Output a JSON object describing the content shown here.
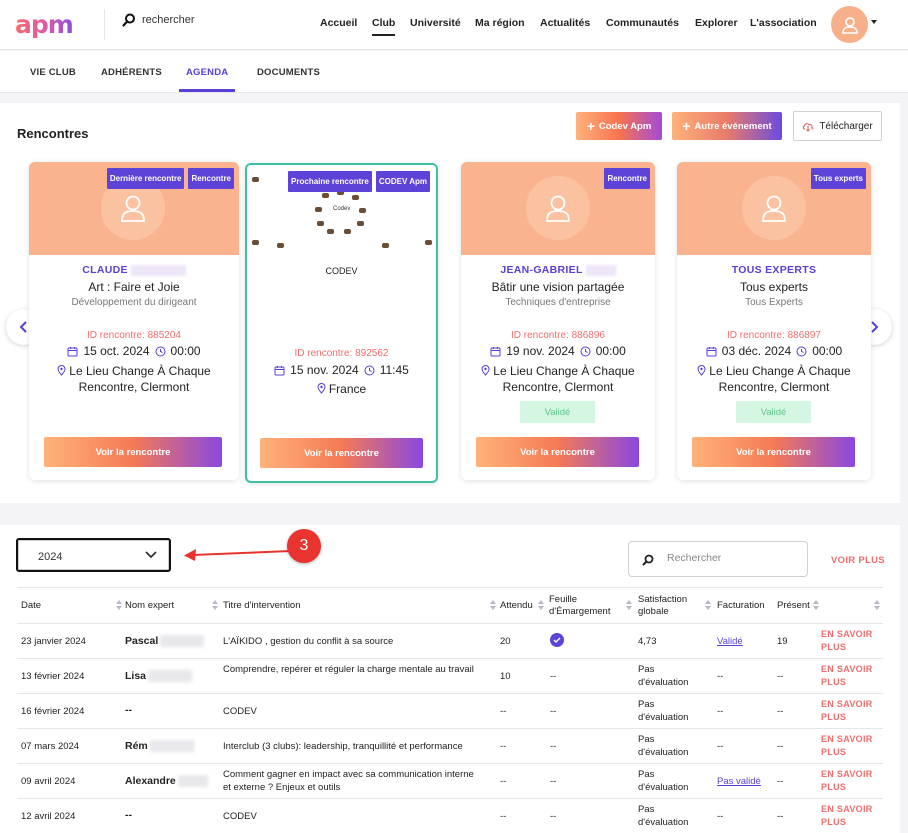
{
  "header": {
    "logo": "apm",
    "search_label": "rechercher",
    "nav": [
      "Accueil",
      "Club",
      "Université",
      "Ma région",
      "Actualités",
      "Communautés",
      "Explorer",
      "L'association"
    ],
    "active_nav": "Club"
  },
  "subnav": {
    "tabs": [
      "VIE CLUB",
      "ADHÉRENTS",
      "AGENDA",
      "DOCUMENTS"
    ],
    "active_tab": "AGENDA"
  },
  "rencontres": {
    "title": "Rencontres",
    "buttons": {
      "codev": "Codev Apm",
      "autre": "Autre événement",
      "telecharger": "Télécharger"
    },
    "cards": [
      {
        "badges": [
          "Dernière rencontre",
          "Rencontre"
        ],
        "name": "CLAUDE",
        "title": "Art : Faire et Joie",
        "subtitle": "Développement du dirigeant",
        "id": "ID rencontre: 885204",
        "date": "15 oct. 2024",
        "time": "00:00",
        "place": "Le Lieu Change À Chaque Rencontre, Clermont",
        "status": "",
        "button": "Voir la rencontre"
      },
      {
        "badges": [
          "Prochaine rencontre",
          "CODEV Apm"
        ],
        "image_caption": "Codev",
        "name": "CODEV",
        "id": "ID rencontre: 892562",
        "date": "15 nov. 2024",
        "time": "11:45",
        "place": "France",
        "button": "Voir la rencontre"
      },
      {
        "badges": [
          "Rencontre"
        ],
        "name": "JEAN-GABRIEL",
        "title": "Bâtir une vision partagée",
        "subtitle": "Techniques d'entreprise",
        "id": "ID rencontre: 886896",
        "date": "19 nov. 2024",
        "time": "00:00",
        "place": "Le Lieu Change À Chaque Rencontre, Clermont",
        "status": "Validé",
        "button": "Voir la rencontre"
      },
      {
        "badges": [
          "Tous experts"
        ],
        "name": "TOUS EXPERTS",
        "title": "Tous experts",
        "subtitle": "Tous Experts",
        "id": "ID rencontre: 886897",
        "date": "03 déc. 2024",
        "time": "00:00",
        "place": "Le Lieu Change À Chaque Rencontre, Clermont",
        "status": "Validé",
        "button": "Voir la rencontre"
      }
    ]
  },
  "agenda": {
    "year": "2024",
    "marker": "3",
    "search_placeholder": "Rechercher",
    "voir_plus": "VOIR PLUS",
    "columns": [
      "Date",
      "Nom expert",
      "Titre d'intervention",
      "Attendu",
      "Feuille d'Émargement",
      "Satisfaction globale",
      "Facturation",
      "Présent"
    ],
    "rows": [
      {
        "date": "23 janvier 2024",
        "expert": "Pascal",
        "titre": "L'AÏKIDO , gestion du conflit à sa source",
        "attendu": "20",
        "feuille": "check",
        "satisfaction": "4,73",
        "facturation": "Validé",
        "present": "19",
        "action": "EN SAVOIR PLUS"
      },
      {
        "date": "13 février 2024",
        "expert": "Lisa",
        "titre": "Comprendre, repérer et réguler la charge mentale au travail",
        "attendu": "10",
        "feuille": "--",
        "satisfaction": "Pas d'évaluation",
        "facturation": "--",
        "present": "--",
        "action": "EN SAVOIR PLUS"
      },
      {
        "date": "16 février 2024",
        "expert": "--",
        "titre": "CODEV",
        "attendu": "--",
        "feuille": "--",
        "satisfaction": "Pas d'évaluation",
        "facturation": "--",
        "present": "--",
        "action": "EN SAVOIR PLUS"
      },
      {
        "date": "07 mars 2024",
        "expert": "Rém",
        "titre": "Interclub (3 clubs): leadership, tranquillité et performance",
        "attendu": "--",
        "feuille": "--",
        "satisfaction": "Pas d'évaluation",
        "facturation": "--",
        "present": "--",
        "action": "EN SAVOIR PLUS"
      },
      {
        "date": "09 avril 2024",
        "expert": "Alexandre",
        "titre": "Comment gagner en impact avec sa communication interne et externe ? Enjeux et outils",
        "attendu": "--",
        "feuille": "--",
        "satisfaction": "Pas d'évaluation",
        "facturation": "Pas validé",
        "present": "--",
        "action": "EN SAVOIR PLUS"
      },
      {
        "date": "12 avril 2024",
        "expert": "--",
        "titre": "CODEV",
        "attendu": "--",
        "feuille": "--",
        "satisfaction": "Pas d'évaluation",
        "facturation": "--",
        "present": "--",
        "action": "EN SAVOIR PLUS"
      }
    ]
  },
  "colors": {
    "accent_purple": "#5a3ed6",
    "accent_red": "#f06d6d",
    "card_orange": "#f9b48f",
    "validated_green": "#5ec68c",
    "highlight_teal": "#3fbfa4"
  }
}
